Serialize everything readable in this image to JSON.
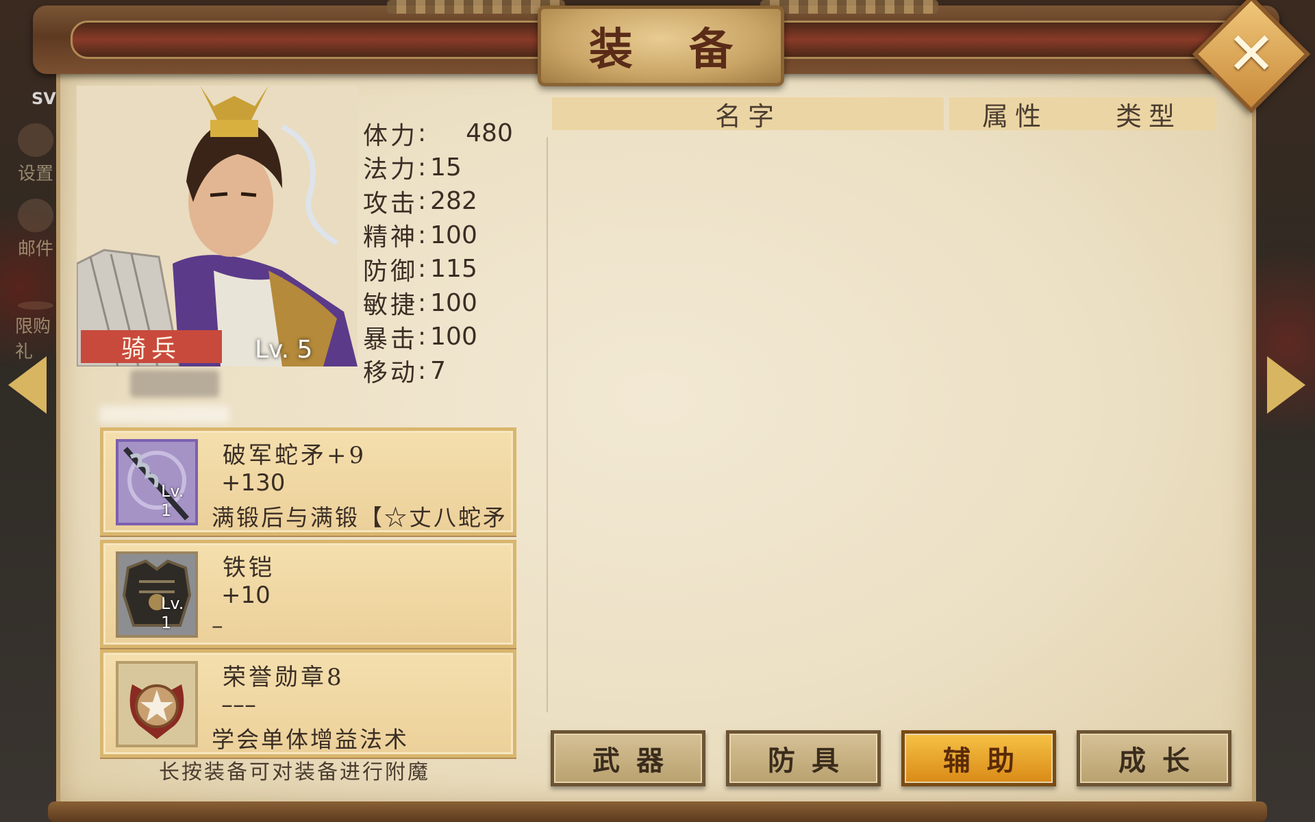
{
  "window": {
    "title": "装 备",
    "close_icon": "close-icon"
  },
  "sidebar": {
    "sv_label": "SV",
    "items": [
      "设置",
      "邮件",
      "限购礼"
    ]
  },
  "hero": {
    "class_label": "骑兵",
    "level_label": "Lv. 5",
    "stats": [
      {
        "label": "体力",
        "value": "480"
      },
      {
        "label": "法力",
        "value": "15"
      },
      {
        "label": "攻击",
        "value": "282"
      },
      {
        "label": "精神",
        "value": "100"
      },
      {
        "label": "防御",
        "value": "115"
      },
      {
        "label": "敏捷",
        "value": "100"
      },
      {
        "label": "暴击",
        "value": "100"
      },
      {
        "label": "移动",
        "value": "7"
      }
    ]
  },
  "equipment": [
    {
      "name": "破军蛇矛+9",
      "bonus": "+130",
      "desc": "满锻后与满锻【☆丈八蛇矛",
      "level": "Lv. 1",
      "icon": "spear-icon"
    },
    {
      "name": "铁铠",
      "bonus": "+10",
      "desc": "–",
      "level": "Lv. 1",
      "icon": "armor-icon"
    },
    {
      "name": "荣誉勋章8",
      "bonus": "–––",
      "desc": "学会单体增益法术",
      "level": "",
      "icon": "medal-icon"
    }
  ],
  "hint": "长按装备可对装备进行附魔",
  "list_header": {
    "name": "名字",
    "attr": "属性",
    "type": "类型"
  },
  "tabs": [
    {
      "label": "武器",
      "active": false
    },
    {
      "label": "防具",
      "active": false
    },
    {
      "label": "辅助",
      "active": true
    },
    {
      "label": "成长",
      "active": false
    }
  ],
  "colors": {
    "accent": "#d98a16",
    "badge": "#c84a3c",
    "parchment": "#ece0c4"
  }
}
